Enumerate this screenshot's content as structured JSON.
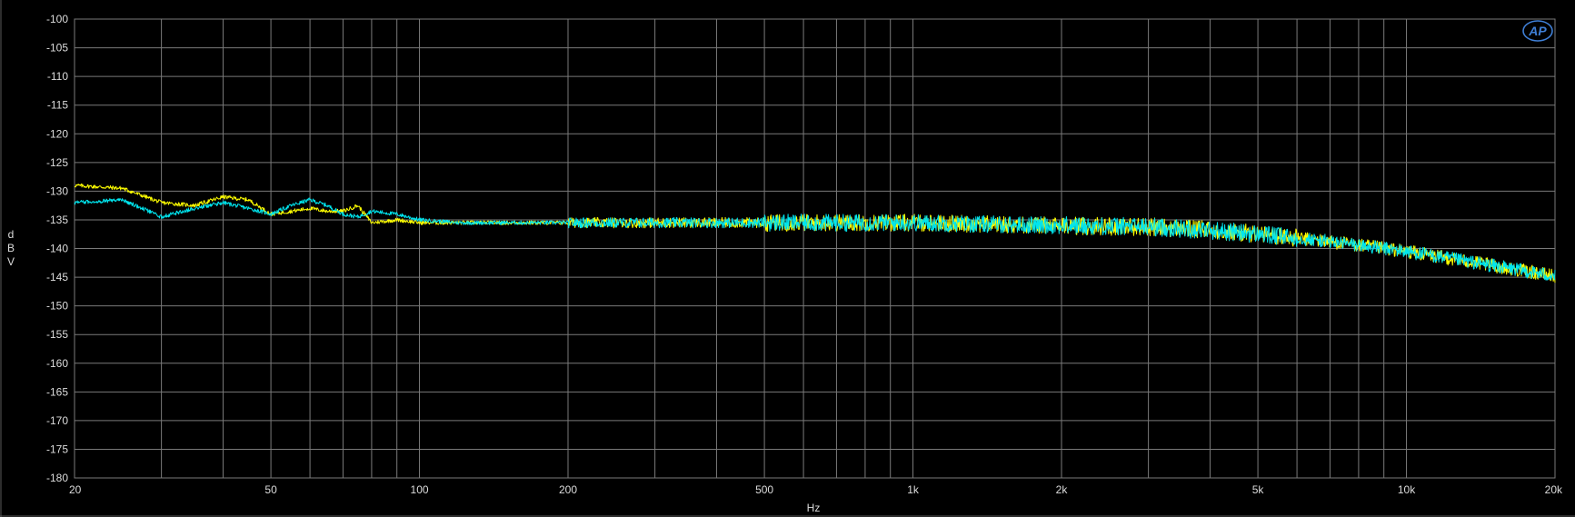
{
  "colors": {
    "background": "#000000",
    "grid": "#7a7a7a",
    "text": "#dcdcdc",
    "logo": "#3f7fd6"
  },
  "logo_text": "AP",
  "chart_data": {
    "type": "line",
    "x_scale": "log",
    "y_scale": "linear",
    "grid": true,
    "xlabel": "Hz",
    "ylabel": "dBV",
    "xlim": [
      20,
      20000
    ],
    "ylim": [
      -180,
      -100
    ],
    "x_ticks": [
      {
        "value": 20,
        "label": "20"
      },
      {
        "value": 50,
        "label": "50"
      },
      {
        "value": 100,
        "label": "100"
      },
      {
        "value": 200,
        "label": "200"
      },
      {
        "value": 500,
        "label": "500"
      },
      {
        "value": 1000,
        "label": "1k"
      },
      {
        "value": 2000,
        "label": "2k"
      },
      {
        "value": 5000,
        "label": "5k"
      },
      {
        "value": 10000,
        "label": "10k"
      },
      {
        "value": 20000,
        "label": "20k"
      }
    ],
    "y_ticks": [
      -100,
      -105,
      -110,
      -115,
      -120,
      -125,
      -130,
      -135,
      -140,
      -145,
      -150,
      -155,
      -160,
      -165,
      -170,
      -175,
      -180
    ],
    "series": [
      {
        "color": "#ffff00",
        "x": [
          20,
          25,
          30,
          35,
          40,
          45,
          50,
          55,
          60,
          65,
          70,
          75,
          80,
          90,
          100,
          120,
          150,
          200,
          300,
          500,
          700,
          1000,
          1500,
          2000,
          3000,
          4000,
          5000,
          7000,
          10000,
          15000,
          20000
        ],
        "values": [
          -129,
          -129.5,
          -132,
          -132.5,
          -131,
          -131.5,
          -134,
          -133.5,
          -133,
          -133.5,
          -133.5,
          -132.5,
          -135.5,
          -135,
          -135.5,
          -135.5,
          -135.5,
          -135.5,
          -135.5,
          -135.5,
          -135.5,
          -135.5,
          -135.8,
          -136,
          -136.2,
          -136.8,
          -137.5,
          -138.8,
          -140.5,
          -143,
          -144.8
        ]
      },
      {
        "color": "#00e5ee",
        "x": [
          20,
          25,
          30,
          35,
          40,
          45,
          50,
          55,
          60,
          65,
          70,
          75,
          80,
          90,
          100,
          120,
          150,
          200,
          300,
          500,
          700,
          1000,
          1500,
          2000,
          3000,
          4000,
          5000,
          7000,
          10000,
          15000,
          20000
        ],
        "values": [
          -132,
          -131.5,
          -134.5,
          -133,
          -132,
          -133,
          -134,
          -132.5,
          -131.5,
          -132.5,
          -134,
          -134.5,
          -133.5,
          -134,
          -135,
          -135.5,
          -135.5,
          -135.5,
          -135.5,
          -135.5,
          -135.5,
          -135.5,
          -135.8,
          -136,
          -136.2,
          -136.8,
          -137.5,
          -138.8,
          -140.5,
          -143,
          -144.8
        ]
      }
    ]
  }
}
